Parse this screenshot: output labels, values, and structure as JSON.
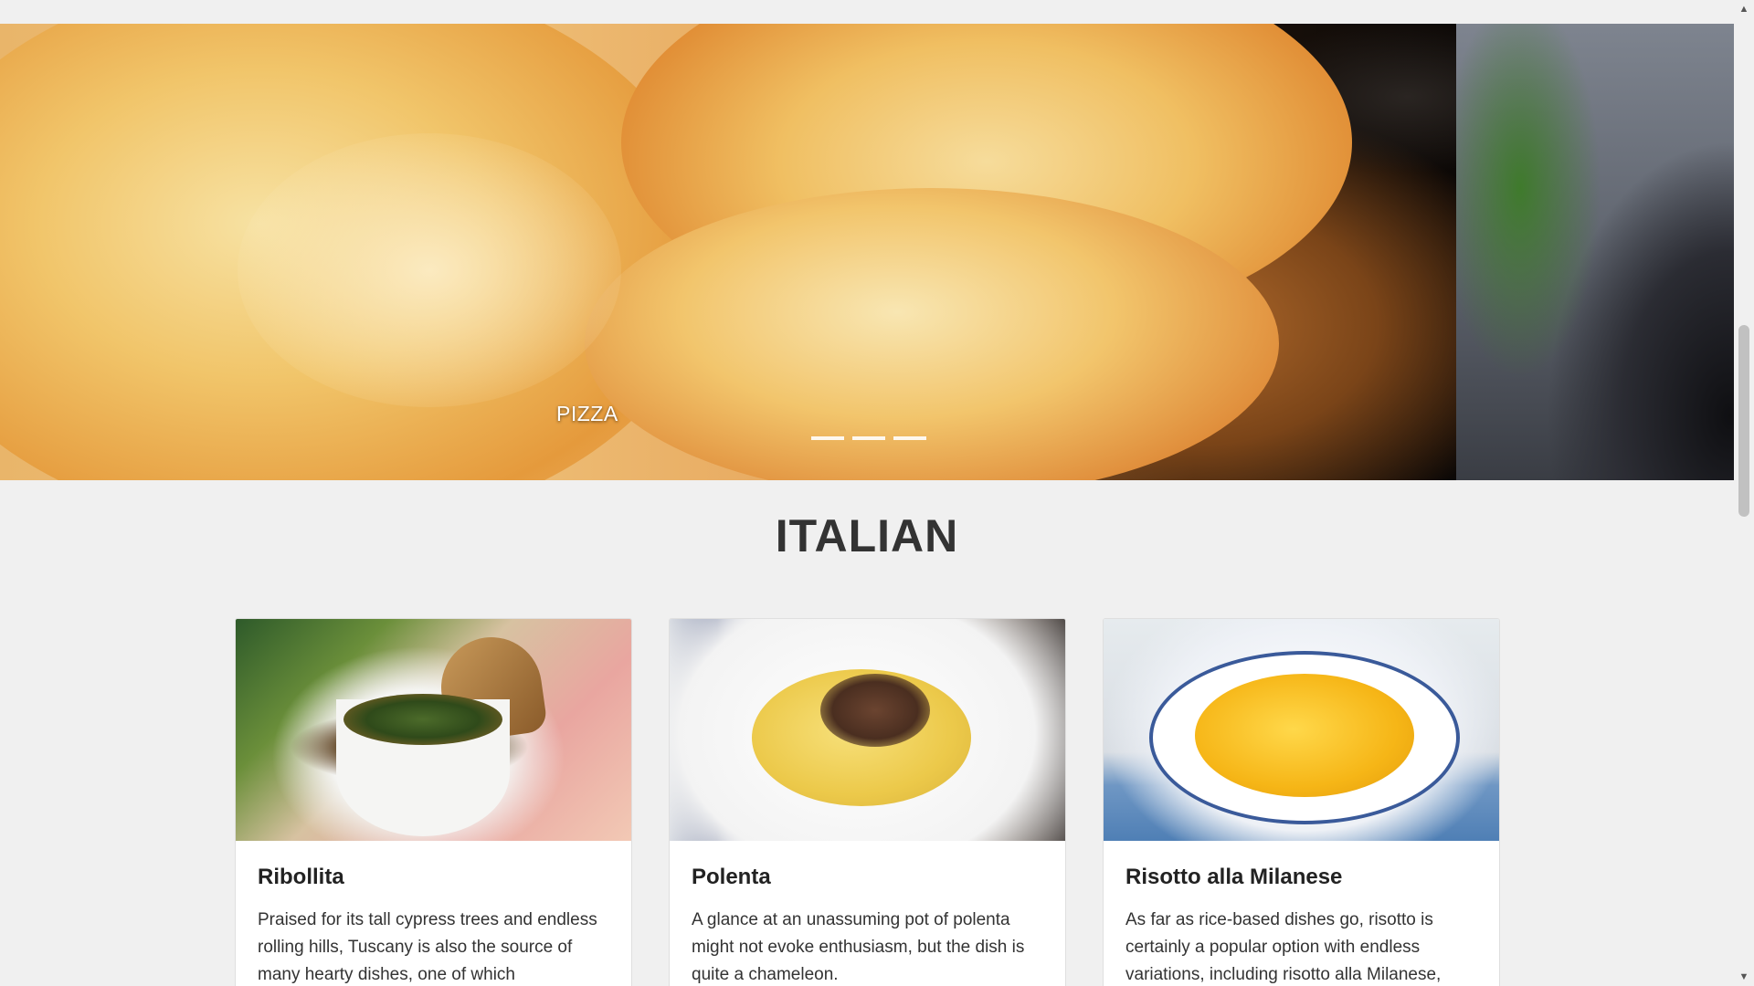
{
  "carousel": {
    "caption": "PIZZA",
    "indicators": [
      "slide-1",
      "slide-2",
      "slide-3"
    ]
  },
  "section": {
    "title": "ITALIAN"
  },
  "cards": [
    {
      "title": "Ribollita",
      "text": "Praised for its tall cypress trees and endless rolling hills, Tuscany is also the source of many hearty dishes, one of which"
    },
    {
      "title": "Polenta",
      "text": "A glance at an unassuming pot of polenta might not evoke enthusiasm, but the dish is quite a chameleon."
    },
    {
      "title": "Risotto alla Milanese",
      "text": "As far as rice-based dishes go, risotto is certainly a popular option with endless variations, including risotto alla Milanese,"
    }
  ],
  "scrollbar": {
    "up_icon": "▲",
    "down_icon": "▼"
  },
  "colors": {
    "page_background": "#f0f0f0",
    "card_background": "#ffffff",
    "heading_text": "#333333"
  }
}
